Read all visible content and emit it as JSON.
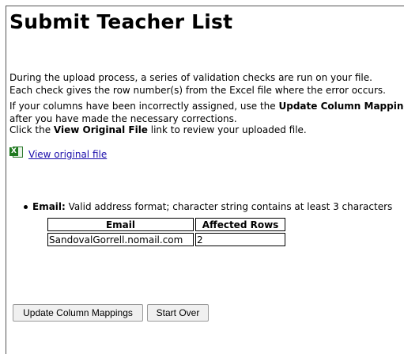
{
  "page": {
    "title": "Submit Teacher List"
  },
  "intro": {
    "line1": "During the upload process, a series of validation checks are run on your file.",
    "line2": "Each check gives the row number(s) from the Excel file where the error occurs."
  },
  "columns_note": {
    "prefix": "If your columns have been incorrectly assigned, use the ",
    "bold": "Update Column Mappings",
    "line2": "after you have made the necessary corrections."
  },
  "view_note": {
    "prefix": "Click the ",
    "bold": "View Original File",
    "suffix": " link to review your uploaded file."
  },
  "file_link": {
    "icon": "excel-file-icon",
    "label": "View original file"
  },
  "errors": [
    {
      "field": "Email:",
      "description": "Valid address format; character string contains at least 3 characters",
      "headers": [
        "Email",
        "Affected Rows"
      ],
      "rows": [
        {
          "email": "SandovalGorrell.nomail.com",
          "affected": "2"
        }
      ]
    }
  ],
  "buttons": {
    "update": "Update Column Mappings",
    "start_over": "Start Over"
  }
}
